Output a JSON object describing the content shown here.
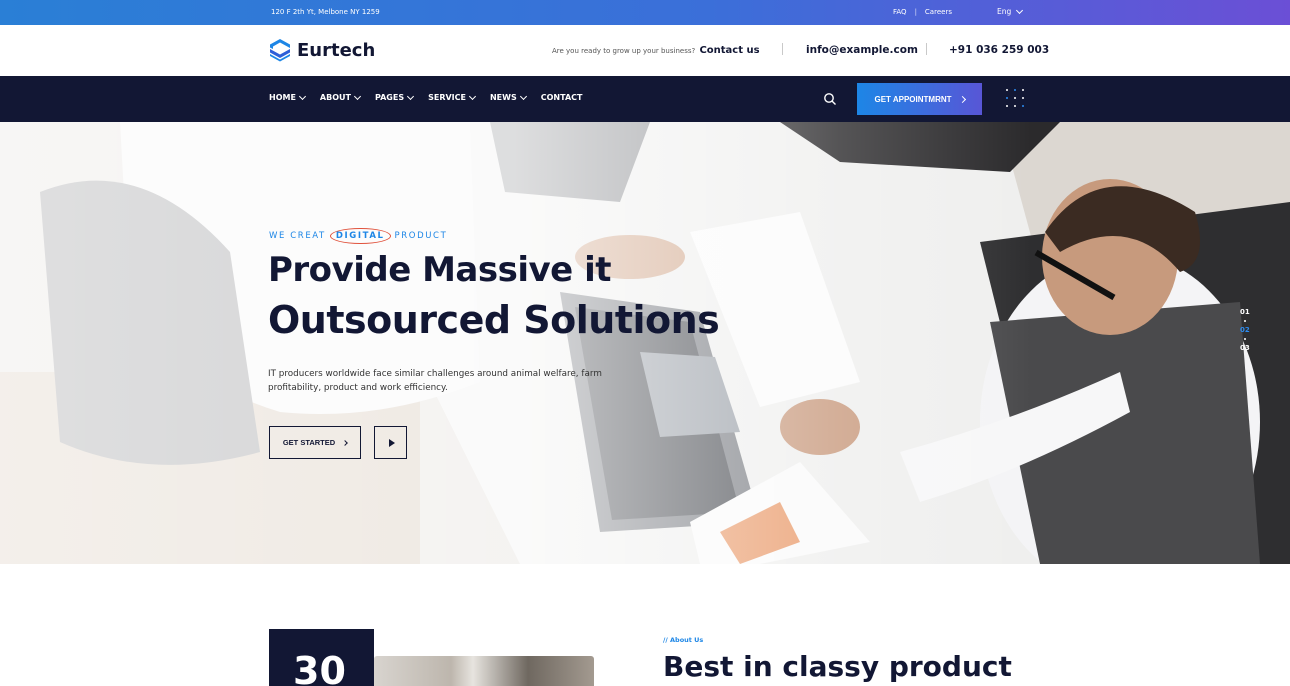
{
  "topbar": {
    "address": "120 F 2th Yt, Melbone NY 1259",
    "faq": "FAQ",
    "separator": "|",
    "careers": "Careers",
    "language": "Eng"
  },
  "header": {
    "logo_text": "Eurtech",
    "question": "Are you ready to grow up your business?",
    "contact_link": "Contact us",
    "email": "info@example.com",
    "phone": "+91 036 259 003"
  },
  "nav": {
    "items": [
      {
        "label": "HOME",
        "dropdown": true
      },
      {
        "label": "ABOUT",
        "dropdown": true
      },
      {
        "label": "PAGES",
        "dropdown": true
      },
      {
        "label": "SERVICE",
        "dropdown": true
      },
      {
        "label": "NEWS",
        "dropdown": true
      },
      {
        "label": "CONTACT",
        "dropdown": false
      }
    ],
    "appointment_button": "GET APPOINTMRNT",
    "search_icon": "search-icon",
    "menu_icon": "grid-dots-icon"
  },
  "hero": {
    "tagline_before": "WE CREAT",
    "tagline_highlight": "DIGITAL",
    "tagline_after": "PRODUCT",
    "title_line1": "Provide Massive it",
    "title_line2": "Outsourced Solutions",
    "description": "IT producers worldwide face similar challenges around animal welfare, farm profitability, product and work efficiency.",
    "cta_button": "GET STARTED",
    "play_icon": "play-icon",
    "slides": [
      "01",
      "02",
      "03"
    ],
    "active_slide": "02"
  },
  "about": {
    "years": "30",
    "tag": "// About Us",
    "title": "Best in classy product"
  },
  "colors": {
    "navy": "#121734",
    "accent_blue": "#1d86e6",
    "accent_purple": "#5856d6",
    "highlight_red": "#e0533d"
  }
}
